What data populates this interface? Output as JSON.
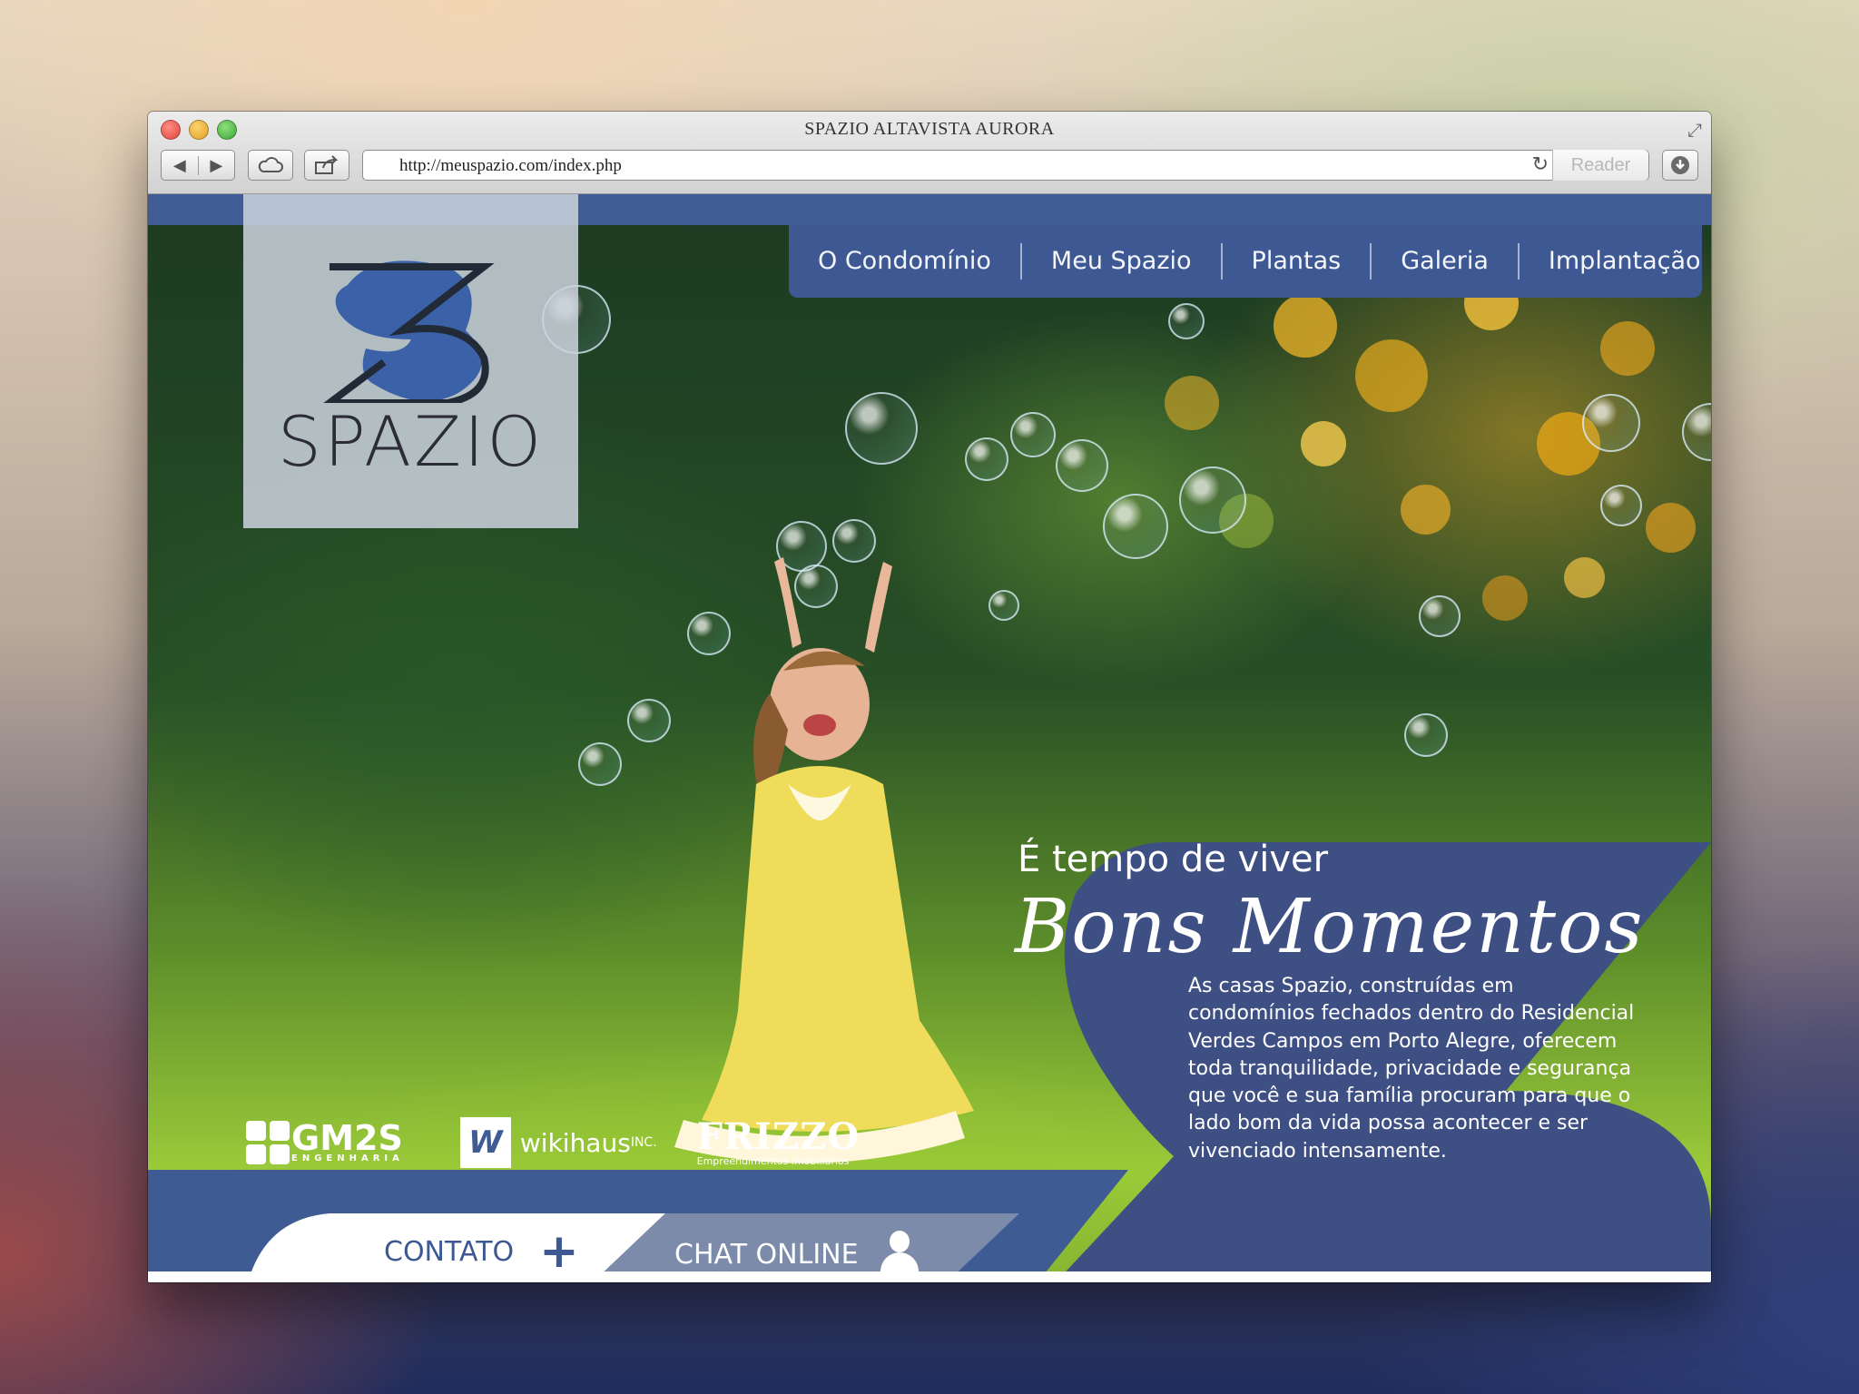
{
  "browser": {
    "window_title": "SPAZIO ALTAVISTA AURORA",
    "url": "http://meuspazio.com/index.php",
    "reader_label": "Reader",
    "icons": {
      "back": "back-arrow-icon",
      "forward": "forward-arrow-icon",
      "icloud": "cloud-icon",
      "share": "share-icon",
      "reload": "reload-icon",
      "downloads": "download-icon",
      "fullscreen": "fullscreen-icon"
    }
  },
  "site": {
    "logo_text": "SPAZIO",
    "nav": [
      "O Condomínio",
      "Meu Spazio",
      "Plantas",
      "Galeria",
      "Implantação"
    ],
    "hero": {
      "headline": "É tempo de viver",
      "script_title": "Bons Momentos",
      "description": "As casas Spazio, construídas em condomínios fechados dentro do Residencial Verdes Campos em Porto Alegre, oferecem toda tranquilidade, privacidade e segurança que você e sua família procuram para que o lado bom da vida possa acontecer e ser vivenciado intensamente."
    },
    "partners": {
      "gm2s": {
        "name": "GM2S",
        "sub": "ENGENHARIA"
      },
      "wikihaus": {
        "mark": "W",
        "name": "wikihaus",
        "suffix": "INC."
      },
      "frizzo": {
        "name": "FRIZZO",
        "sub": "Empreendimentos Imobiliários"
      }
    },
    "contact_label": "CONTATO",
    "chat_label": "CHAT ONLINE",
    "colors": {
      "primary_blue": "#3d5892",
      "panel_blue": "#3e4f84",
      "white": "#ffffff"
    }
  }
}
